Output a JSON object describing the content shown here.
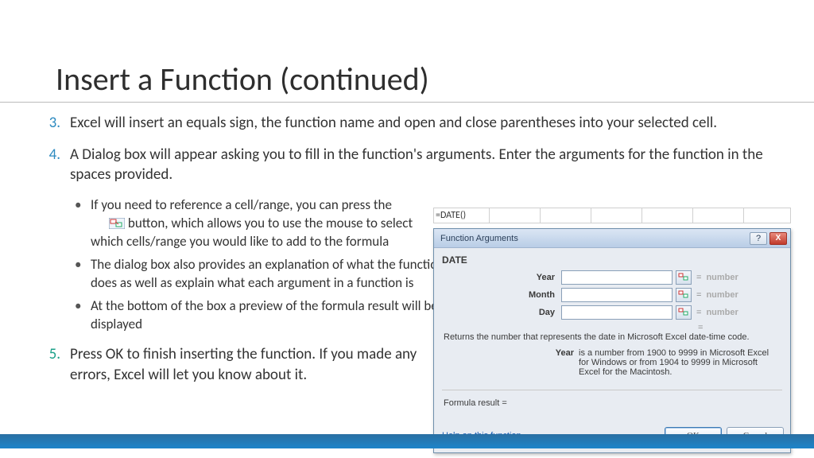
{
  "title": "Insert a Function (continued)",
  "steps": {
    "n3": "3.",
    "t3": "Excel will insert an equals sign, the function name and open and close parentheses into your selected cell.",
    "n4": "4.",
    "t4": "A Dialog box will appear asking you to fill in the function's arguments. Enter the arguments for the function in the spaces provided.",
    "n5": "5.",
    "t5": "Press OK to finish inserting the function. If you made any errors, Excel will let you know about it."
  },
  "sub": {
    "a_pre": "If you need to reference a cell/range, you can press the ",
    "a_post": " button, which allows you to use the mouse to select which cells/range you would like to add to the formula",
    "b": "The dialog box also provides an explanation of what the function does as well as explain what each argument in a function is",
    "c": "At the bottom of the box a preview of the formula result will be displayed"
  },
  "excel": {
    "formula": "=DATE()",
    "dialog_title": "Function Arguments",
    "function_name": "DATE",
    "args": [
      {
        "label": "Year",
        "placeholder": "number"
      },
      {
        "label": "Month",
        "placeholder": "number"
      },
      {
        "label": "Day",
        "placeholder": "number"
      }
    ],
    "eq_only": "=",
    "description": "Returns the number that represents the date in Microsoft Excel date-time code.",
    "arg_desc_key": "Year",
    "arg_desc_val": "is a number from 1900 to 9999 in Microsoft Excel for Windows or from 1904 to 9999 in Microsoft Excel for the Macintosh.",
    "formula_result": "Formula result =",
    "help": "Help on this function",
    "ok": "OK",
    "cancel": "Cancel",
    "help_glyph": "?",
    "close_glyph": "X",
    "eq": "="
  }
}
